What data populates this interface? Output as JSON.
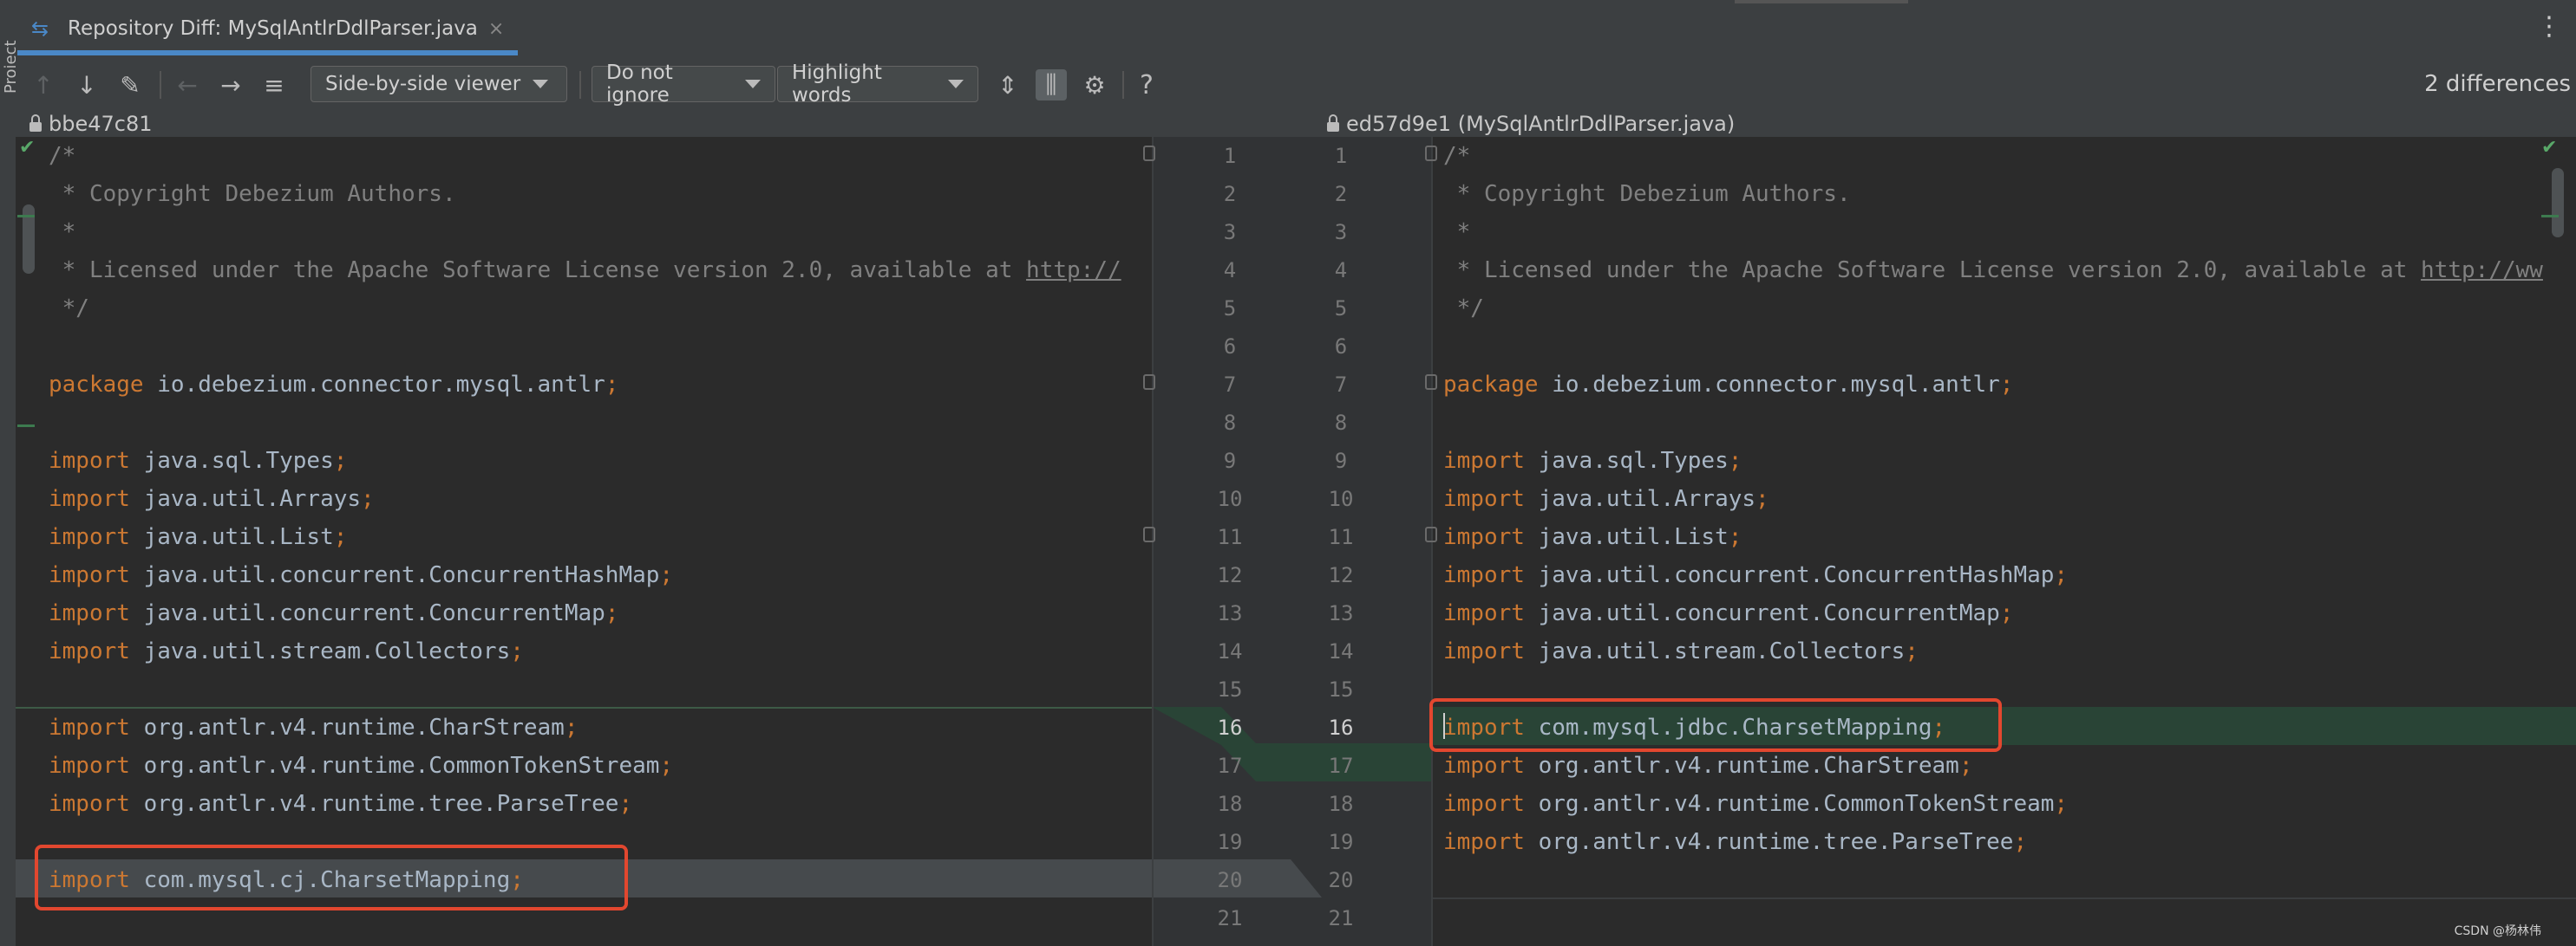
{
  "side_panel": {
    "label": "Project"
  },
  "tab": {
    "title": "Repository Diff: MySqlAntlrDdlParser.java",
    "close": "×",
    "icon": "diff-icon"
  },
  "toolbar": {
    "viewer": "Side-by-side viewer",
    "ignore": "Do not ignore",
    "highlight": "Highlight words",
    "help": "?",
    "differences": "2 differences",
    "icons": [
      "arrow-up-icon",
      "arrow-down-icon",
      "edit-icon",
      "arrow-left-icon",
      "arrow-right-icon",
      "list-icon",
      "collapse-icon",
      "sync-scroll-icon",
      "gear-icon",
      "help-icon"
    ]
  },
  "left_header": {
    "revision": "bbe47c81"
  },
  "right_header": {
    "revision": "ed57d9e1 (MySqlAntlrDdlParser.java)"
  },
  "colors": {
    "keyword": "#cc7832",
    "plain": "#a9b7c6",
    "comment": "#808080",
    "changed_bg": "#294436",
    "box": "#e2472f"
  },
  "left_lines": [
    {
      "parts": [
        [
          "cm",
          "/*"
        ]
      ]
    },
    {
      "parts": [
        [
          "cm",
          " * Copyright Debezium Authors."
        ]
      ]
    },
    {
      "parts": [
        [
          "cm",
          " *"
        ]
      ]
    },
    {
      "parts": [
        [
          "cm",
          " * Licensed under the Apache Software License version 2.0, available at "
        ],
        [
          "lnk",
          "http://"
        ]
      ]
    },
    {
      "parts": [
        [
          "cm",
          " */"
        ]
      ]
    },
    {
      "parts": []
    },
    {
      "parts": [
        [
          "kw",
          "package "
        ],
        [
          "pl",
          "io.debezium.connector.mysql.antlr"
        ],
        [
          "pu",
          ";"
        ]
      ]
    },
    {
      "parts": []
    },
    {
      "parts": [
        [
          "kw",
          "import "
        ],
        [
          "pl",
          "java.sql.Types"
        ],
        [
          "pu",
          ";"
        ]
      ]
    },
    {
      "parts": [
        [
          "kw",
          "import "
        ],
        [
          "pl",
          "java.util.Arrays"
        ],
        [
          "pu",
          ";"
        ]
      ]
    },
    {
      "parts": [
        [
          "kw",
          "import "
        ],
        [
          "pl",
          "java.util.List"
        ],
        [
          "pu",
          ";"
        ]
      ]
    },
    {
      "parts": [
        [
          "kw",
          "import "
        ],
        [
          "pl",
          "java.util.concurrent.ConcurrentHashMap"
        ],
        [
          "pu",
          ";"
        ]
      ]
    },
    {
      "parts": [
        [
          "kw",
          "import "
        ],
        [
          "pl",
          "java.util.concurrent.ConcurrentMap"
        ],
        [
          "pu",
          ";"
        ]
      ]
    },
    {
      "parts": [
        [
          "kw",
          "import "
        ],
        [
          "pl",
          "java.util.stream.Collectors"
        ],
        [
          "pu",
          ";"
        ]
      ]
    },
    {
      "parts": []
    },
    {
      "parts": [
        [
          "kw",
          "import "
        ],
        [
          "pl",
          "org.antlr.v4.runtime.CharStream"
        ],
        [
          "pu",
          ";"
        ]
      ]
    },
    {
      "parts": [
        [
          "kw",
          "import "
        ],
        [
          "pl",
          "org.antlr.v4.runtime.CommonTokenStream"
        ],
        [
          "pu",
          ";"
        ]
      ]
    },
    {
      "parts": [
        [
          "kw",
          "import "
        ],
        [
          "pl",
          "org.antlr.v4.runtime.tree.ParseTree"
        ],
        [
          "pu",
          ";"
        ]
      ]
    },
    {
      "parts": []
    },
    {
      "parts": [
        [
          "kw",
          "import "
        ],
        [
          "pl",
          "com.mysql.cj.CharsetMapping"
        ],
        [
          "pu",
          ";"
        ]
      ]
    },
    {
      "parts": []
    }
  ],
  "right_lines": [
    {
      "parts": [
        [
          "cm",
          "/*"
        ]
      ]
    },
    {
      "parts": [
        [
          "cm",
          " * Copyright Debezium Authors."
        ]
      ]
    },
    {
      "parts": [
        [
          "cm",
          " *"
        ]
      ]
    },
    {
      "parts": [
        [
          "cm",
          " * Licensed under the Apache Software License version 2.0, available at "
        ],
        [
          "lnk",
          "http://ww"
        ]
      ]
    },
    {
      "parts": [
        [
          "cm",
          " */"
        ]
      ]
    },
    {
      "parts": []
    },
    {
      "parts": [
        [
          "kw",
          "package "
        ],
        [
          "pl",
          "io.debezium.connector.mysql.antlr"
        ],
        [
          "pu",
          ";"
        ]
      ]
    },
    {
      "parts": []
    },
    {
      "parts": [
        [
          "kw",
          "import "
        ],
        [
          "pl",
          "java.sql.Types"
        ],
        [
          "pu",
          ";"
        ]
      ]
    },
    {
      "parts": [
        [
          "kw",
          "import "
        ],
        [
          "pl",
          "java.util.Arrays"
        ],
        [
          "pu",
          ";"
        ]
      ]
    },
    {
      "parts": [
        [
          "kw",
          "import "
        ],
        [
          "pl",
          "java.util.List"
        ],
        [
          "pu",
          ";"
        ]
      ]
    },
    {
      "parts": [
        [
          "kw",
          "import "
        ],
        [
          "pl",
          "java.util.concurrent.ConcurrentHashMap"
        ],
        [
          "pu",
          ";"
        ]
      ]
    },
    {
      "parts": [
        [
          "kw",
          "import "
        ],
        [
          "pl",
          "java.util.concurrent.ConcurrentMap"
        ],
        [
          "pu",
          ";"
        ]
      ]
    },
    {
      "parts": [
        [
          "kw",
          "import "
        ],
        [
          "pl",
          "java.util.stream.Collectors"
        ],
        [
          "pu",
          ";"
        ]
      ]
    },
    {
      "parts": []
    },
    {
      "parts": [
        [
          "kw",
          "import "
        ],
        [
          "pl",
          "com.mysql.jdbc.CharsetMapping"
        ],
        [
          "pu",
          ";"
        ]
      ]
    },
    {
      "parts": [
        [
          "kw",
          "import "
        ],
        [
          "pl",
          "org.antlr.v4.runtime.CharStream"
        ],
        [
          "pu",
          ";"
        ]
      ]
    },
    {
      "parts": [
        [
          "kw",
          "import "
        ],
        [
          "pl",
          "org.antlr.v4.runtime.CommonTokenStream"
        ],
        [
          "pu",
          ";"
        ]
      ]
    },
    {
      "parts": [
        [
          "kw",
          "import "
        ],
        [
          "pl",
          "org.antlr.v4.runtime.tree.ParseTree"
        ],
        [
          "pu",
          ";"
        ]
      ]
    },
    {
      "parts": []
    },
    {
      "parts": []
    }
  ],
  "left_numbers": [
    "1",
    "2",
    "3",
    "4",
    "5",
    "6",
    "7",
    "8",
    "9",
    "10",
    "11",
    "12",
    "13",
    "14",
    "15",
    "16",
    "17",
    "18",
    "19",
    "20",
    "21"
  ],
  "right_numbers": [
    "1",
    "2",
    "3",
    "4",
    "5",
    "6",
    "7",
    "8",
    "9",
    "10",
    "11",
    "12",
    "13",
    "14",
    "15",
    "16",
    "17",
    "18",
    "19",
    "20",
    "21"
  ],
  "watermark": "CSDN @杨林伟"
}
